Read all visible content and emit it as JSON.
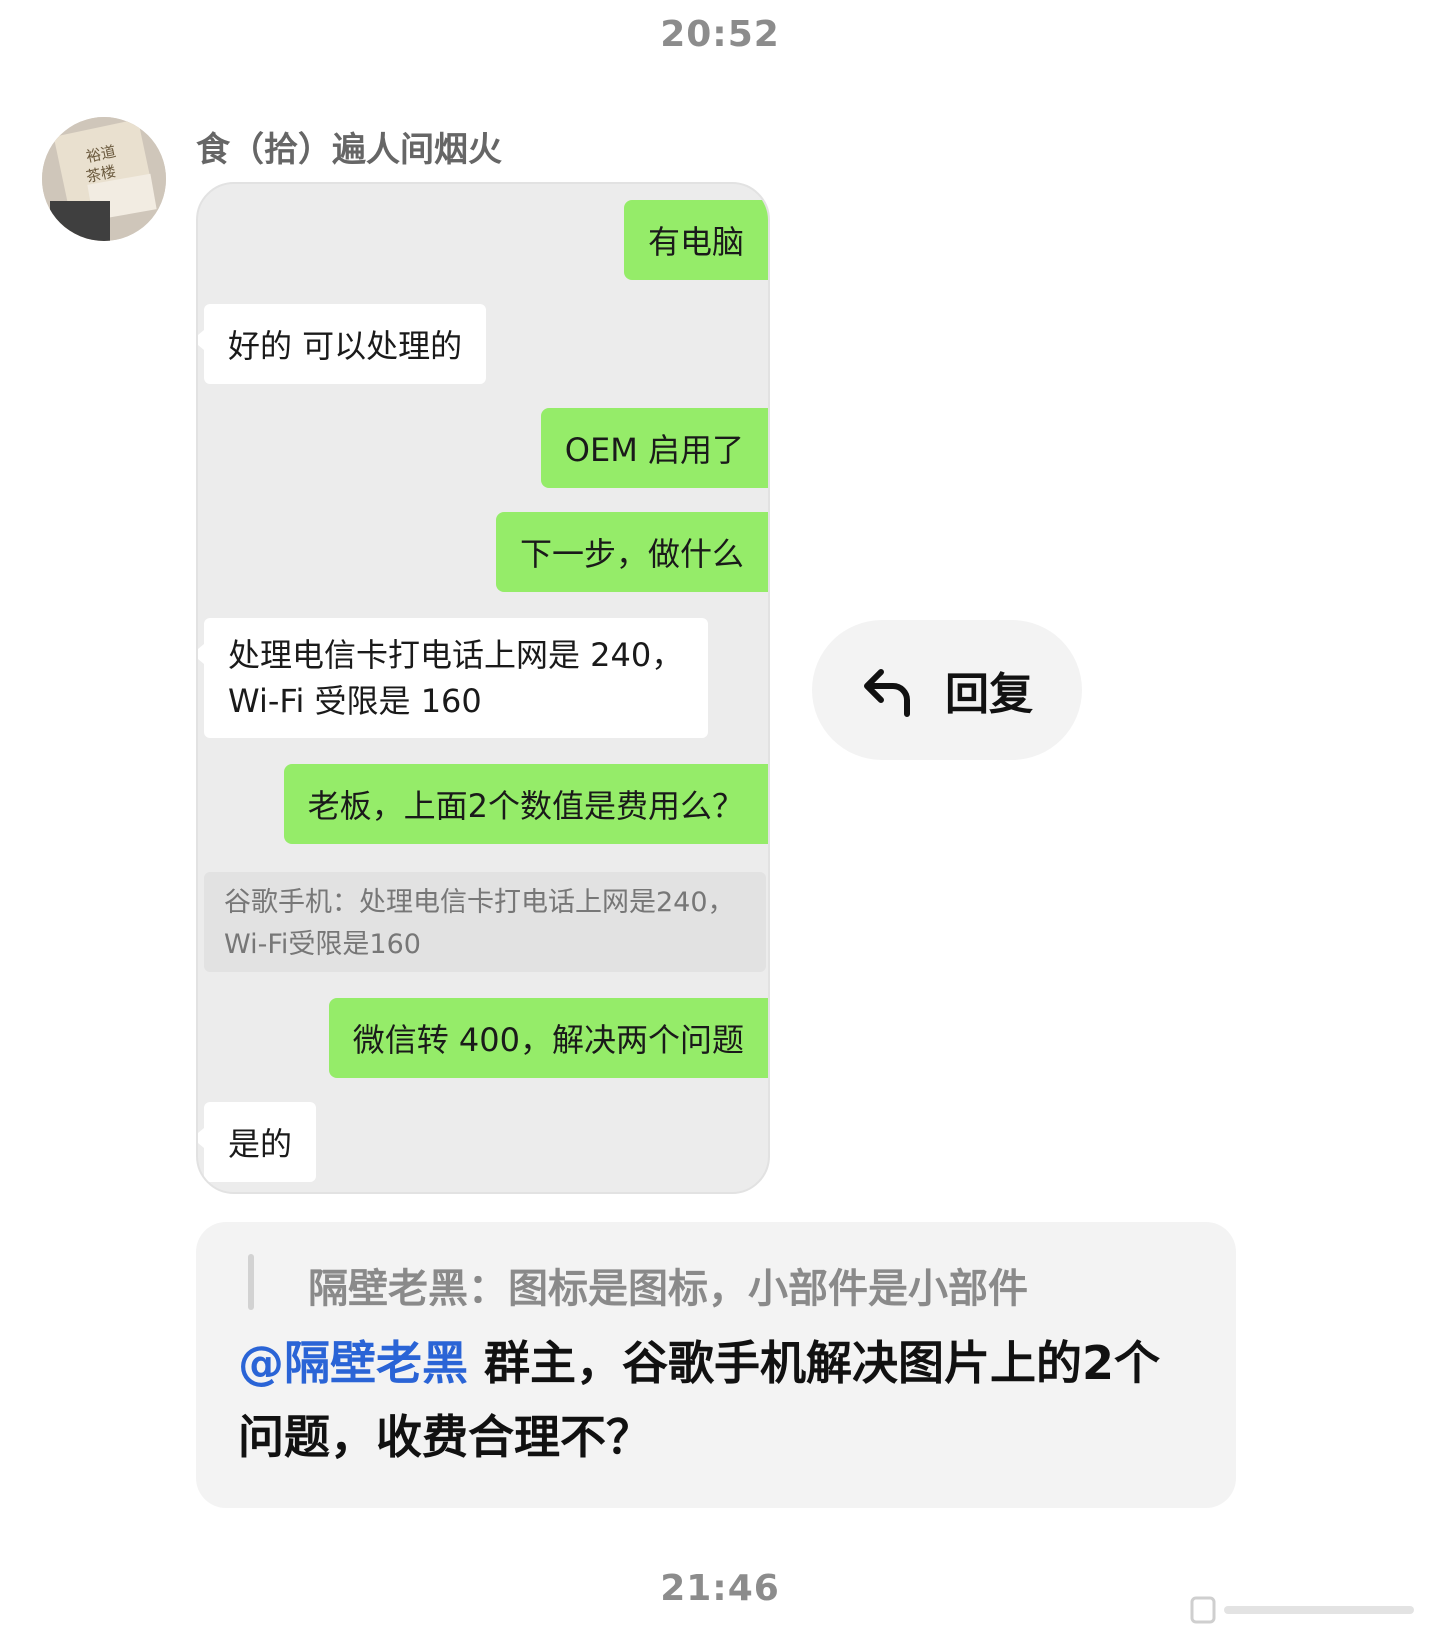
{
  "timestamps": {
    "top": "20:52",
    "bottom": "21:46"
  },
  "sender": {
    "name": "食（拾）遍人间烟火",
    "avatar_text_line1": "裕道",
    "avatar_text_line2": "茶楼"
  },
  "screenshot": {
    "messages": [
      {
        "side": "me",
        "text": "有电脑"
      },
      {
        "side": "them",
        "text": "好的 可以处理的"
      },
      {
        "side": "me",
        "text": "OEM 启用了"
      },
      {
        "side": "me",
        "text": "下一步，做什么"
      },
      {
        "side": "them",
        "line1": "处理电信卡打电话上网是 240，",
        "line2": "Wi-Fi 受限是 160"
      },
      {
        "side": "me",
        "text": "老板，上面2个数值是费用么？"
      },
      {
        "side": "quote",
        "line1": "谷歌手机：处理电信卡打电话上网是240，",
        "line2": "Wi-Fi受限是160"
      },
      {
        "side": "me",
        "text": "微信转 400，解决两个问题"
      },
      {
        "side": "them",
        "text": "是的"
      }
    ]
  },
  "reply_action": {
    "label": "回复",
    "icon": "reply-arrow-icon"
  },
  "outgoing": {
    "quote": "隔壁老黑：图标是图标，小部件是小部件",
    "mention": "@隔壁老黑",
    "text": " 群主，谷歌手机解决图片上的2个问题，收费合理不？"
  },
  "colors": {
    "bubble_me": "#95ec69",
    "bubble_them": "#ffffff",
    "mention": "#2a64d6"
  }
}
